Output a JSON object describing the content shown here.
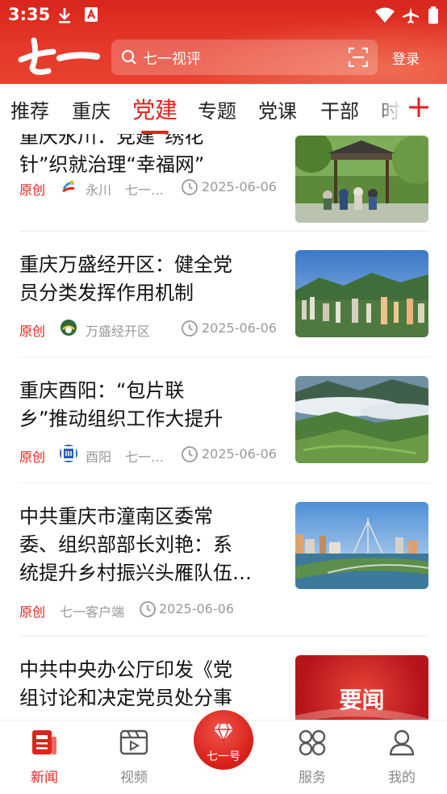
{
  "status": {
    "time": "3:35"
  },
  "header": {
    "logo_text": "七一",
    "search_placeholder": "七一视评",
    "login_label": "登录"
  },
  "tabs": [
    {
      "label": "推荐"
    },
    {
      "label": "重庆"
    },
    {
      "label": "党建",
      "active": true
    },
    {
      "label": "专题"
    },
    {
      "label": "党课"
    },
    {
      "label": "干部"
    },
    {
      "label": "时"
    }
  ],
  "articles": [
    {
      "title": "重庆永川：党建“绣花针”织就治理“幸福网”",
      "title_lines": [
        "重庆永川：党建“绣花",
        "针”织就治理“幸福网”"
      ],
      "tag": "原创",
      "source": "永川",
      "source2": "七一…",
      "date": "2025-06-06"
    },
    {
      "title": "重庆万盛经开区：健全党员分类发挥作用机制",
      "title_lines": [
        "重庆万盛经开区：健全党",
        "员分类发挥作用机制"
      ],
      "tag": "原创",
      "source": "万盛经开区",
      "date": "2025-06-06"
    },
    {
      "title": "重庆酉阳：“包片联乡”推动组织工作大提升",
      "title_lines": [
        "重庆酉阳：“包片联",
        "乡”推动组织工作大提升"
      ],
      "tag": "原创",
      "source": "酉阳",
      "source2": "七一…",
      "date": "2025-06-06"
    },
    {
      "title": "中共重庆市潼南区委常委、组织部部长刘艳：系统提升乡村振兴头雁队伍…",
      "title_lines": [
        "中共重庆市潼南区委常",
        "委、组织部部长刘艳：系",
        "统提升乡村振兴头雁队伍…"
      ],
      "tag": "原创",
      "source": "七一客户端",
      "date": "2025-06-06"
    },
    {
      "title": "中共中央办公厅印发《党组讨论和决定党员处分事",
      "title_lines": [
        "中共中央办公厅印发《党",
        "组讨论和决定党员处分事"
      ],
      "thumb_text": "要闻"
    }
  ],
  "bottom_nav": [
    {
      "label": "新闻",
      "icon": "news-icon",
      "active": true
    },
    {
      "label": "视频",
      "icon": "video-icon"
    },
    {
      "label": "七一号",
      "icon": "diamond-icon"
    },
    {
      "label": "服务",
      "icon": "services-icon"
    },
    {
      "label": "我的",
      "icon": "profile-icon"
    }
  ],
  "colors": {
    "brand": "#e0231b",
    "header": "#e33a2a",
    "meta": "#999999"
  }
}
